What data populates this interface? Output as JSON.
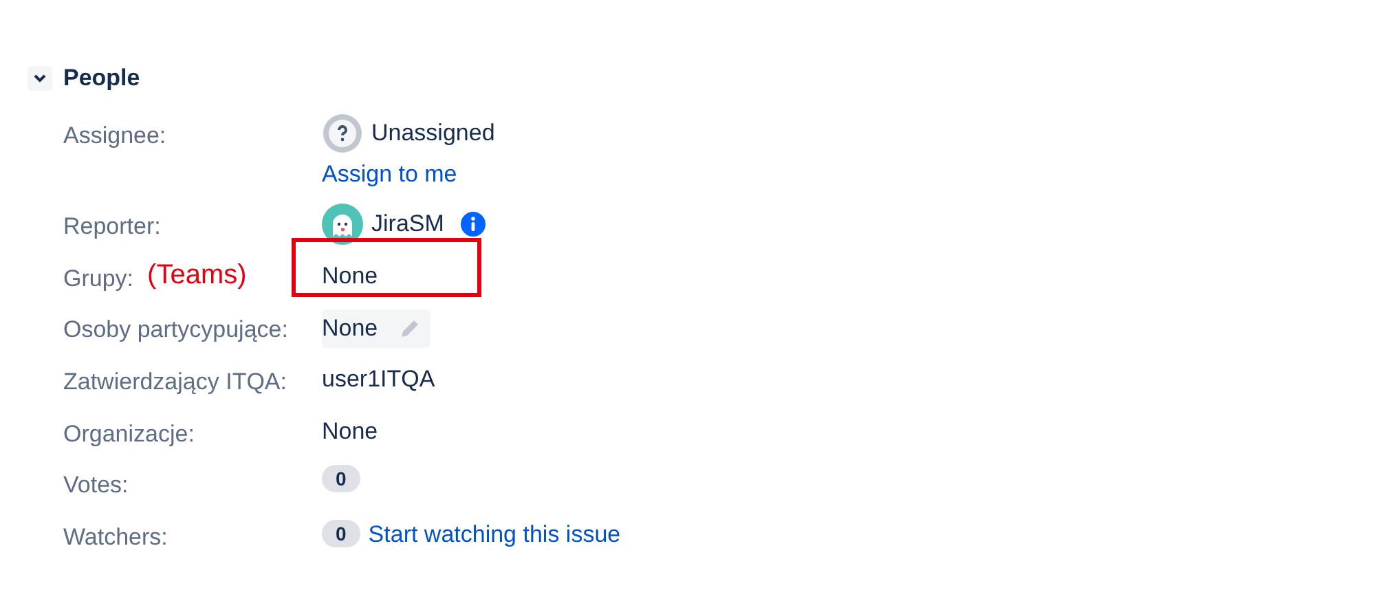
{
  "section": {
    "title": "People",
    "expanded": true
  },
  "rows": [
    {
      "label": "Assignee:",
      "kind": "avatar",
      "avatar": {
        "kind": "unknown"
      },
      "value": "Unassigned",
      "link": "Assign to me"
    },
    {
      "label": "Reporter:",
      "kind": "avatar",
      "avatar": {
        "kind": "bot"
      },
      "value": "JiraSM",
      "info": true
    },
    {
      "label": "Grupy:",
      "kind": "text",
      "value": "None",
      "annotation": "(Teams)",
      "highlighted": true
    },
    {
      "label": "Osoby partycypujące:",
      "kind": "editable",
      "value": "None"
    },
    {
      "label": "Zatwierdzający ITQA:",
      "kind": "text",
      "value": "user1ITQA"
    },
    {
      "label": "Organizacje:",
      "kind": "text",
      "value": "None"
    },
    {
      "label": "Votes:",
      "kind": "count",
      "value": "0"
    },
    {
      "label": "Watchers:",
      "kind": "count",
      "value": "0",
      "link": "Start watching this issue"
    }
  ]
}
